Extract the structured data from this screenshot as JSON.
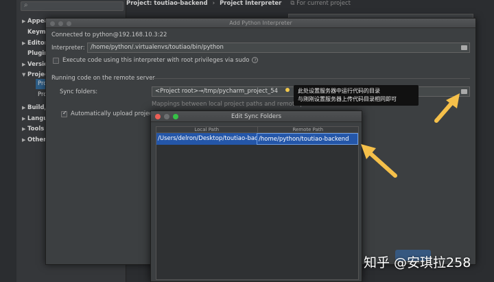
{
  "settings": {
    "search_icon": "search-icon",
    "header_project": "Project: toutiao-backend",
    "header_separator": "›",
    "header_section": "Project Interpreter",
    "header_note": "For current project",
    "tree": [
      {
        "arrow": "▶",
        "label": "Appearance & Behavior"
      },
      {
        "arrow": "",
        "label": "Keymap"
      },
      {
        "arrow": "▶",
        "label": "Editor"
      },
      {
        "arrow": "",
        "label": "Plugins"
      },
      {
        "arrow": "▶",
        "label": "Version Control"
      },
      {
        "arrow": "▼",
        "label": "Project: toutiao-backend"
      },
      {
        "arrow": "▶",
        "label": "Build, Execution, Deployment"
      },
      {
        "arrow": "▶",
        "label": "Languages & Frameworks"
      },
      {
        "arrow": "▶",
        "label": "Tools"
      },
      {
        "arrow": "▶",
        "label": "Other Settings"
      }
    ],
    "tree_sub": [
      "Project Interpreter",
      "Project Structure"
    ]
  },
  "dialog": {
    "title": "Add Python Interpreter",
    "connected": "Connected to python@192.168.10.3:22",
    "interpreter_label": "Interpreter:",
    "interpreter_value": "/home/python/.virtualenvs/toutiao/bin/python",
    "sudo_label": "Execute code using this interpreter with root privileges via sudo",
    "sudo_checked": false,
    "remote_section": "Running code on the remote server",
    "sync_label": "Sync folders:",
    "sync_value": "<Project root>→/tmp/pycharm_project_54",
    "mappings_hint": "Mappings between local project paths and remote paths on the server",
    "auto_upload_label": "Automatically upload project",
    "auto_upload_checked": true,
    "help_icon": "question-circle-icon"
  },
  "tooltip": {
    "line1": "此处设置服务器中运行代码的目录",
    "line2": "与刚刚设置服务器上传代码目录相同即可"
  },
  "sync_dialog": {
    "title": "Edit Sync Folders",
    "columns": [
      "Local Path",
      "Remote Path"
    ],
    "rows": [
      {
        "local": "/Users/delron/Desktop/toutiao-backend",
        "remote": "/home/python/toutiao-backend"
      }
    ]
  },
  "annotation_color": "#f5c04a",
  "watermark": "知乎 @安琪拉258"
}
